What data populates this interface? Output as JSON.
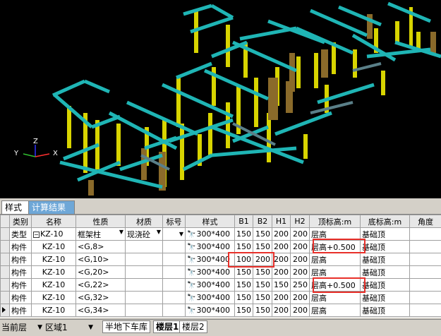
{
  "tabs": [
    {
      "label": "样式",
      "active": false
    },
    {
      "label": "计算结果",
      "active": true
    }
  ],
  "viewport": {
    "axes": {
      "x": "X",
      "y": "Y",
      "z": "Z"
    }
  },
  "table": {
    "columns": [
      "类别",
      "名称",
      "性质",
      "材质",
      "标号",
      "样式",
      "B1",
      "B2",
      "H1",
      "H2",
      "顶标高:m",
      "底标高:m",
      "角度"
    ],
    "rows": [
      {
        "type": "类型",
        "name": "KZ-10",
        "nature": "框架柱",
        "material": "现浇砼",
        "grade": "",
        "style": "300*400",
        "b1": "150",
        "b2": "150",
        "h1": "200",
        "h2": "200",
        "top": "层高",
        "bottom": "基础顶",
        "angle": ""
      },
      {
        "type": "构件",
        "name": "KZ-10",
        "nature": "<G,8>",
        "material": "",
        "grade": "",
        "style": "300*400",
        "b1": "150",
        "b2": "150",
        "h1": "200",
        "h2": "200",
        "top": "层高+0.500",
        "bottom": "基础顶",
        "angle": ""
      },
      {
        "type": "构件",
        "name": "KZ-10",
        "nature": "<G,10>",
        "material": "",
        "grade": "",
        "style": "300*400",
        "b1": "100",
        "b2": "200",
        "h1": "200",
        "h2": "200",
        "top": "层高",
        "bottom": "基础顶",
        "angle": ""
      },
      {
        "type": "构件",
        "name": "KZ-10",
        "nature": "<G,20>",
        "material": "",
        "grade": "",
        "style": "300*400",
        "b1": "150",
        "b2": "150",
        "h1": "200",
        "h2": "200",
        "top": "层高",
        "bottom": "基础顶",
        "angle": ""
      },
      {
        "type": "构件",
        "name": "KZ-10",
        "nature": "<G,22>",
        "material": "",
        "grade": "",
        "style": "300*400",
        "b1": "150",
        "b2": "150",
        "h1": "150",
        "h2": "250",
        "top": "层高+0.500",
        "bottom": "基础顶",
        "angle": ""
      },
      {
        "type": "构件",
        "name": "KZ-10",
        "nature": "<G,32>",
        "material": "",
        "grade": "",
        "style": "300*400",
        "b1": "150",
        "b2": "150",
        "h1": "200",
        "h2": "200",
        "top": "层高",
        "bottom": "基础顶",
        "angle": ""
      },
      {
        "type": "构件",
        "name": "KZ-10",
        "nature": "<G,34>",
        "material": "",
        "grade": "",
        "style": "300*400",
        "b1": "150",
        "b2": "150",
        "h1": "200",
        "h2": "200",
        "top": "层高",
        "bottom": "基础顶",
        "angle": ""
      }
    ]
  },
  "status": {
    "layer_label": "当前层",
    "zone_value": "区域1",
    "layer_tabs": [
      "半地下车库",
      "楼层1",
      "楼层2"
    ]
  },
  "colors": {
    "beam": "#1fb5b5",
    "column_yellow": "#d8d400",
    "column_brown": "#8a6a2a",
    "highlight": "#e8302a",
    "active_tab": "#6ea7d7"
  }
}
